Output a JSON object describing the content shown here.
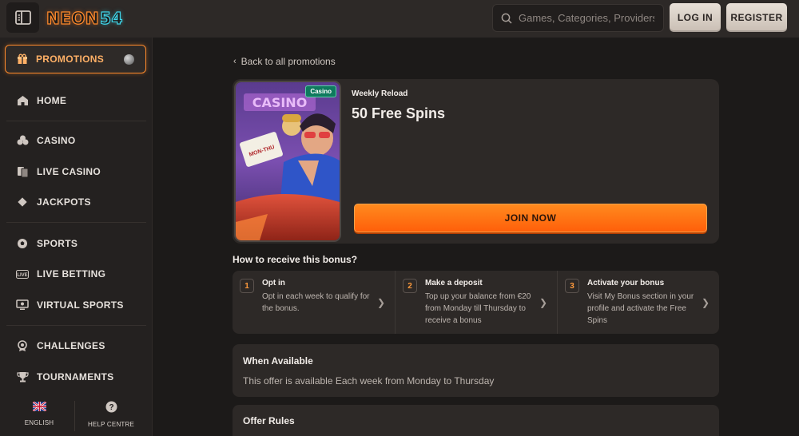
{
  "header": {
    "logo_part1": "NEON",
    "logo_part2": "54",
    "search_placeholder": "Games, Categories, Providers",
    "login_label": "LOG IN",
    "register_label": "REGISTER"
  },
  "sidebar": {
    "promotions": "PROMOTIONS",
    "items": [
      {
        "label": "HOME",
        "icon": "home-icon"
      },
      {
        "label": "CASINO",
        "icon": "cards-suit-icon"
      },
      {
        "label": "LIVE CASINO",
        "icon": "live-cards-icon"
      },
      {
        "label": "JACKPOTS",
        "icon": "dice-icon"
      },
      {
        "label": "SPORTS",
        "icon": "soccer-ball-icon"
      },
      {
        "label": "LIVE BETTING",
        "icon": "live-badge-icon"
      },
      {
        "label": "VIRTUAL SPORTS",
        "icon": "monitor-icon"
      },
      {
        "label": "CHALLENGES",
        "icon": "medal-icon"
      },
      {
        "label": "TOURNAMENTS",
        "icon": "trophy-icon"
      }
    ],
    "language_label": "ENGLISH",
    "help_label": "HELP CENTRE"
  },
  "main": {
    "back_label": "Back to all promotions",
    "bonus": {
      "badge": "Casino",
      "subtitle": "Weekly Reload",
      "title": "50 Free Spins",
      "join_label": "JOIN NOW"
    },
    "how_title": "How to receive this bonus?",
    "steps": [
      {
        "num": "1",
        "title": "Opt in",
        "desc": "Opt in each week to qualify for the bonus."
      },
      {
        "num": "2",
        "title": "Make a deposit",
        "desc": "Top up your balance from €20 from Monday till Thursday to receive a bonus"
      },
      {
        "num": "3",
        "title": "Activate your bonus",
        "desc": "Visit My Bonus section in your profile and activate the Free Spins"
      }
    ],
    "availability": {
      "title": "When Available",
      "text": "This offer is available Each week from Monday to Thursday"
    },
    "rules_title": "Offer Rules"
  },
  "colors": {
    "accent": "#ff8a2b",
    "bg": "#1c1a19",
    "panel": "#2d2927",
    "join_button": "#ff6a10"
  }
}
